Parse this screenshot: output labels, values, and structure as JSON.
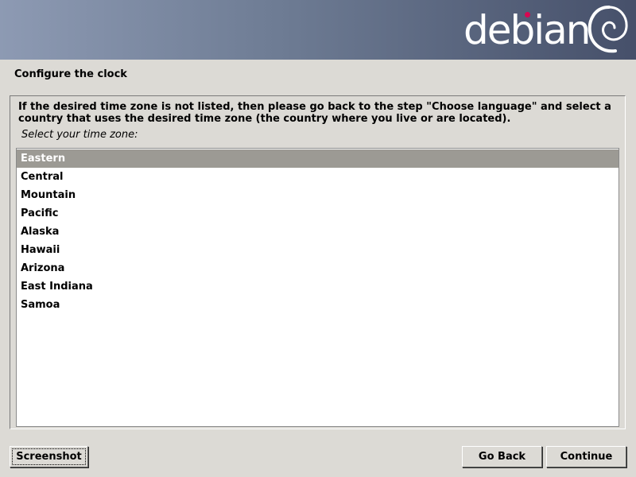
{
  "banner": {
    "logo_text": "debian",
    "logo_accent_color": "#d70751"
  },
  "step": {
    "title": "Configure the clock"
  },
  "info": {
    "text": "If the desired time zone is not listed, then please go back to the step \"Choose language\" and select a country that uses the desired time zone (the country where you live or are located)."
  },
  "prompt": {
    "label": "Select your time zone:"
  },
  "timezones": {
    "selected": "Eastern",
    "items": [
      "Eastern",
      "Central",
      "Mountain",
      "Pacific",
      "Alaska",
      "Hawaii",
      "Arizona",
      "East Indiana",
      "Samoa"
    ]
  },
  "buttons": {
    "screenshot": "Screenshot",
    "go_back": "Go Back",
    "continue": "Continue"
  }
}
